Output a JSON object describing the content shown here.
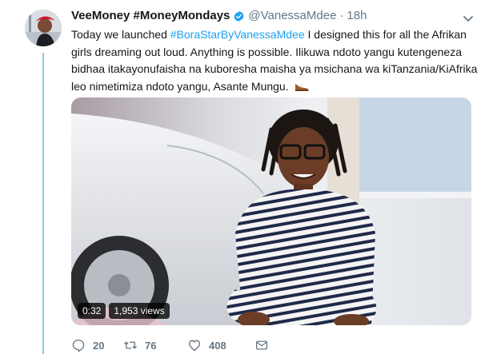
{
  "tweet": {
    "display_name": "VeeMoney #MoneyMondays",
    "handle": "@VanessaMdee",
    "separator": "·",
    "time": "18h",
    "text_parts": {
      "lead": "Today we launched ",
      "hashtag": "#BoraStarByVanessaMdee",
      "rest": " I designed this for all the Afrikan girls dreaming out loud. Anything is possible. Ilikuwa ndoto yangu kutengeneza bidhaa itakayonufaisha na kuboresha maisha ya msichana wa kiTanzania/KiAfrika leo nimetimiza ndoto yangu, Asante Mungu."
    },
    "emoji": "shoe-emoji"
  },
  "video": {
    "duration": "0:32",
    "views": "1,953 views"
  },
  "actions": {
    "replies": "20",
    "retweets": "76",
    "likes": "408"
  },
  "colors": {
    "accent": "#1da1f2",
    "muted": "#657786",
    "thread_line": "#8ec9eb"
  }
}
